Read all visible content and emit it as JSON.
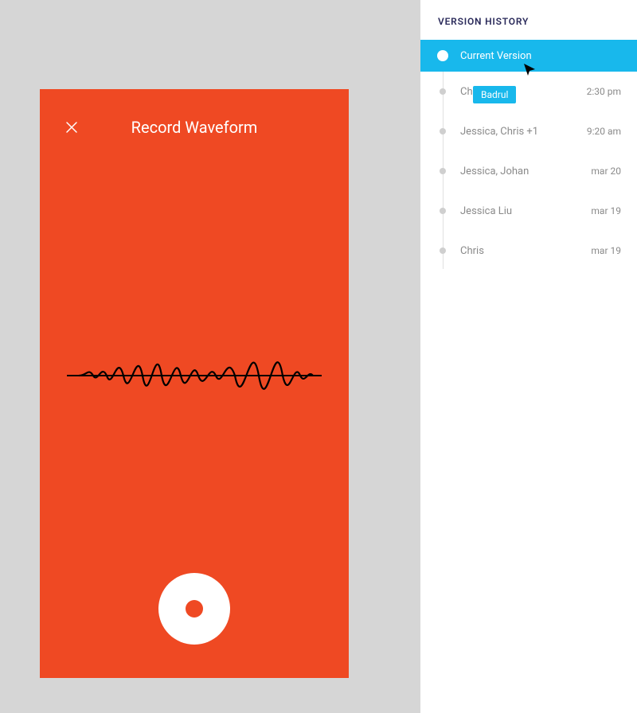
{
  "phone": {
    "title": "Record Waveform",
    "accent": "#ef4923"
  },
  "history": {
    "title": "VERSION HISTORY",
    "selected_accent": "#18b8ec",
    "items": [
      {
        "label": "Current Version",
        "time": "",
        "current": true
      },
      {
        "label": "Chris",
        "time": "2:30 pm",
        "current": false
      },
      {
        "label": "Jessica, Chris +1",
        "time": "9:20 am",
        "current": false
      },
      {
        "label": "Jessica, Johan",
        "time": "mar 20",
        "current": false
      },
      {
        "label": "Jessica Liu",
        "time": "mar 19",
        "current": false
      },
      {
        "label": "Chris",
        "time": "mar 19",
        "current": false
      }
    ]
  },
  "user_chip": {
    "name": "Badrul"
  }
}
